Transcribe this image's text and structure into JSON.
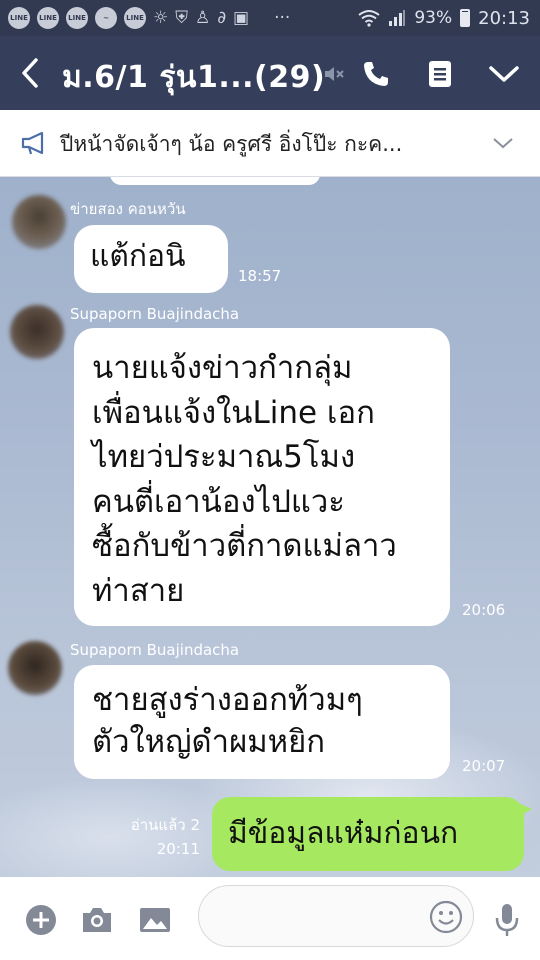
{
  "status_bar": {
    "notification_icons": [
      "LINE",
      "LINE",
      "LINE",
      "messenger",
      "LINE",
      "brightness",
      "shield",
      "person-add",
      "link",
      "image",
      "more"
    ],
    "battery": "93%",
    "time": "20:13"
  },
  "header": {
    "title": "ม.6/1 รุ่น1...(29)"
  },
  "announcement": {
    "text": "ปีหน้าจัดเจ้าๆ น้อ ครูศรี อิ่งโป๊ะ กะค..."
  },
  "messages": [
    {
      "sender": "ข่ายสอง คอนหวัน",
      "text": "แต้ก่อนิ",
      "time": "18:57"
    },
    {
      "sender": "Supaporn Buajindacha",
      "text": "นายแจ้งข่าวกำกลุ่ม\nเพื่อนแจ้งในLine เอก\nไทยว่ประมาณ5โมง\nคนตี่เอาน้องไปแวะ\nซื้อกับข้าวตี่กาดแม่ลาว\nท่าสาย",
      "time": "20:06"
    },
    {
      "sender": "Supaporn Buajindacha",
      "text": "ชายสูงร่างออกท้วมๆ\nตัวใหญ่ดำผมหยิก",
      "time": "20:07"
    }
  ],
  "my_message": {
    "text": "มีข้อมูลแห๋มก่อนก",
    "read_label": "อ่านแล้ว 2",
    "time": "20:11"
  },
  "input_bar": {
    "placeholder": ""
  },
  "colors": {
    "header_bg": "#353f5c",
    "status_bg": "#323a52",
    "my_bubble": "#a6e860",
    "chat_bg": "#aab9d1"
  }
}
